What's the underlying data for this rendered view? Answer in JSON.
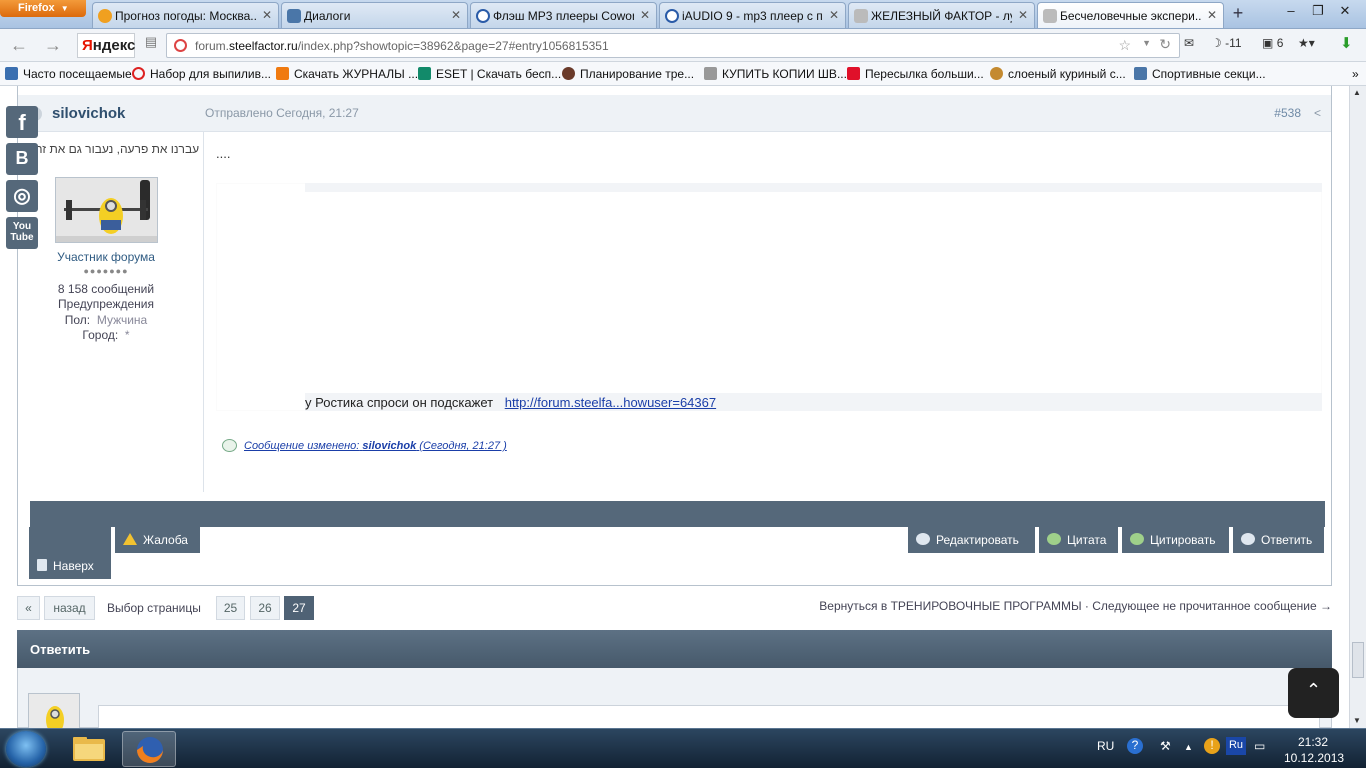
{
  "browser": {
    "firefox_label": "Firefox",
    "tabs": [
      {
        "title": "Прогноз погоды: Москва..."
      },
      {
        "title": "Диалоги"
      },
      {
        "title": "Флэш MP3 плееры Cowon..."
      },
      {
        "title": "iAUDIO 9 - mp3 плеер с п..."
      },
      {
        "title": "ЖЕЛЕЗНЫЙ ФАКТОР - луч..."
      },
      {
        "title": "Бесчеловечные экспери..."
      }
    ],
    "new_tab": "+",
    "yandex_first": "Я",
    "yandex_rest": "ндекс",
    "url_prefix": "forum.",
    "url_domain": "steelfactor.ru",
    "url_path": "/index.php?showtopic=38962&page=27#entry1056815351",
    "weather_temp": "-11",
    "notifications_count": "6",
    "bookmarks": [
      {
        "label": "Часто посещаемые"
      },
      {
        "label": "Набор для выпилив..."
      },
      {
        "label": "Скачать ЖУРНАЛЫ ..."
      },
      {
        "label": "ESET | Скачать бесп..."
      },
      {
        "label": "Планирование тре..."
      },
      {
        "label": "КУПИТЬ КОПИИ ШВ..."
      },
      {
        "label": "Пересылка больши..."
      },
      {
        "label": "слоеный куриный с..."
      },
      {
        "label": "Спортивные секци..."
      }
    ],
    "bookmark_overflow": "»",
    "colors": {
      "accent": "#55687a"
    }
  },
  "post": {
    "author": "silovichok",
    "posted": "Отправлено Сегодня, 21:27",
    "post_number": "#538",
    "share_icon": "share-icon",
    "motto": "עברנו את פרעה, נעבור גם את זה",
    "rank": "Участник форума",
    "pips": "●●●●●●●",
    "messages": "8 158 сообщений",
    "warnings": "Предупреждения",
    "gender_label": "Пол:",
    "gender_value": "Мужчина",
    "city_label": "Город:",
    "city_value": "*",
    "body_dots": "....",
    "reply_text": "у Ростика спроси он подскажет",
    "link_text": "http://forum.steelfa...howuser=64367",
    "edited_prefix": "Сообщение изменено:",
    "edited_user": "silovichok",
    "edited_time": "(Сегодня, 21:27 )"
  },
  "actions": {
    "complaint": "Жалоба",
    "top": "Наверх",
    "edit": "Редактировать",
    "quote": "Цитата",
    "multiquote": "Цитировать",
    "reply": "Ответить"
  },
  "pagination": {
    "first": "«",
    "back": "назад",
    "label": "Выбор страницы",
    "pages": [
      "25",
      "26",
      "27"
    ],
    "current": "27",
    "return_link": "Вернуться в ТРЕНИРОВОЧНЫЕ ПРОГРАММЫ · Следующее не прочитанное сообщение →"
  },
  "reply_section": {
    "title": "Ответить",
    "to_top": "⌃"
  },
  "social": {
    "facebook": "f",
    "vk": "B",
    "instagram": "◎",
    "youtube_top": "You",
    "youtube_bottom": "Tube"
  },
  "taskbar": {
    "lang": "RU",
    "help": "?",
    "kbd": "Ru",
    "time": "21:32",
    "date": "10.12.2013"
  }
}
